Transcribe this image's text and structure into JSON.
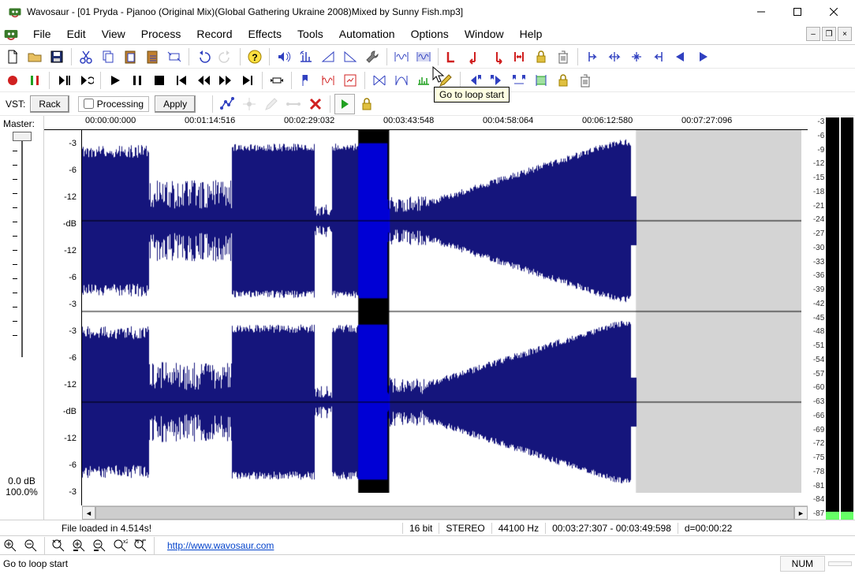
{
  "title": "Wavosaur - [01 Pryda - Pjanoo (Original Mix)(Global Gathering Ukraine 2008)Mixed by Sunny Fish.mp3]",
  "menu": [
    "File",
    "Edit",
    "View",
    "Process",
    "Record",
    "Effects",
    "Tools",
    "Automation",
    "Options",
    "Window",
    "Help"
  ],
  "vst_label": "VST:",
  "rack_btn": "Rack",
  "processing_chk": "Processing",
  "apply_btn": "Apply",
  "master": {
    "label": "Master:",
    "gain": "0.0 dB",
    "percent": "100.0%"
  },
  "ruler": [
    "00:00:00:000",
    "00:01:14:516",
    "00:02:29:032",
    "00:03:43:548",
    "00:04:58:064",
    "00:06:12:580",
    "00:07:27:096"
  ],
  "db_labels": [
    "-3",
    "-6",
    "-12",
    "-dB",
    "-12",
    "-6",
    "-3",
    "-3",
    "-6",
    "-12",
    "-dB",
    "-12",
    "-6",
    "-3"
  ],
  "meter_scale": [
    "-3",
    "-6",
    "-9",
    "-12",
    "-15",
    "-18",
    "-21",
    "-24",
    "-27",
    "-30",
    "-33",
    "-36",
    "-39",
    "-42",
    "-45",
    "-48",
    "-51",
    "-54",
    "-57",
    "-60",
    "-63",
    "-66",
    "-69",
    "-72",
    "-75",
    "-78",
    "-81",
    "-84",
    "-87"
  ],
  "status": {
    "file_msg": "File loaded in 4.514s!",
    "bits": "16 bit",
    "channels": "STEREO",
    "rate": "44100 Hz",
    "selection": "00:03:27:307 - 00:03:49:598",
    "duration": "d=00:00:22"
  },
  "link": "http://www.wavosaur.com",
  "tooltip": "Go to loop start",
  "statusbar": {
    "msg": "Go to loop start",
    "num": "NUM"
  },
  "waveform": {
    "audio_end_norm": 0.77,
    "sel_start_norm": 0.384,
    "sel_end_norm": 0.427,
    "selection_color": "#0000ff",
    "wave_color": "#15157c",
    "tail_color": "#d4d4d4"
  }
}
